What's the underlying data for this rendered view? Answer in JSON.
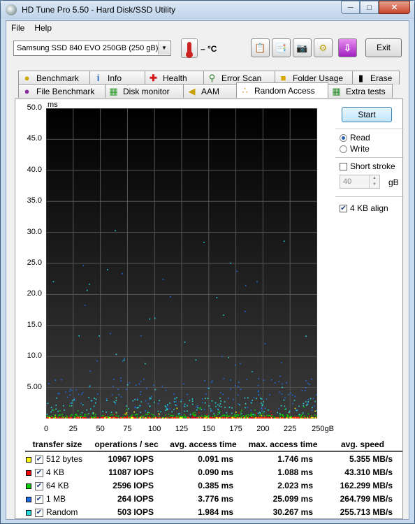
{
  "window": {
    "title": "HD Tune Pro 5.50 - Hard Disk/SSD Utility"
  },
  "menu": {
    "file": "File",
    "help": "Help"
  },
  "toolbar": {
    "drive": "Samsung SSD 840 EVO 250GB (250 gB)",
    "temperature": "– °C",
    "exit_label": "Exit",
    "buttons": [
      "copy-info-icon",
      "copy-screen-icon",
      "screenshot-icon",
      "options-icon",
      "save-icon"
    ]
  },
  "tabs_row1": [
    "Benchmark",
    "Info",
    "Health",
    "Error Scan",
    "Folder Usage",
    "Erase"
  ],
  "tabs_row2": [
    "File Benchmark",
    "Disk monitor",
    "AAM",
    "Random Access",
    "Extra tests"
  ],
  "active_tab": "Random Access",
  "side": {
    "start_label": "Start",
    "read_label": "Read",
    "write_label": "Write",
    "mode": "Read",
    "short_stroke_label": "Short stroke",
    "short_stroke_checked": false,
    "short_stroke_value": "40",
    "short_stroke_unit": "gB",
    "align_label": "4 KB align",
    "align_checked": true
  },
  "chart_data": {
    "type": "scatter",
    "ylabel": "ms",
    "xunit": "gB",
    "ylim": [
      0,
      50
    ],
    "xlim": [
      0,
      250
    ],
    "yticks": [
      "50.0",
      "45.0",
      "40.0",
      "35.0",
      "30.0",
      "25.0",
      "20.0",
      "15.0",
      "10.0",
      "5.00"
    ],
    "xticks": [
      "0",
      "25",
      "50",
      "75",
      "100",
      "125",
      "150",
      "175",
      "200",
      "225",
      "250gB"
    ],
    "grid": true,
    "background": "#000000",
    "series": [
      {
        "name": "512 bytes",
        "color": "#ffff00",
        "avg_ms": 0.091,
        "max_ms": 1.746
      },
      {
        "name": "4 KB",
        "color": "#ff0000",
        "avg_ms": 0.09,
        "max_ms": 1.088
      },
      {
        "name": "64 KB",
        "color": "#00cc00",
        "avg_ms": 0.385,
        "max_ms": 2.023
      },
      {
        "name": "1 MB",
        "color": "#1e6ee6",
        "avg_ms": 3.776,
        "max_ms": 25.099
      },
      {
        "name": "Random",
        "color": "#22dddd",
        "avg_ms": 1.984,
        "max_ms": 30.267
      }
    ]
  },
  "results": {
    "headers": [
      "transfer size",
      "operations / sec",
      "avg. access time",
      "max. access time",
      "avg. speed"
    ],
    "rows": [
      {
        "label": "512 bytes",
        "color": "#ffff00",
        "ops": "10967 IOPS",
        "avg": "0.091 ms",
        "max": "1.746 ms",
        "speed": "5.355 MB/s"
      },
      {
        "label": "4 KB",
        "color": "#ff0000",
        "ops": "11087 IOPS",
        "avg": "0.090 ms",
        "max": "1.088 ms",
        "speed": "43.310 MB/s"
      },
      {
        "label": "64 KB",
        "color": "#00cc00",
        "ops": "2596 IOPS",
        "avg": "0.385 ms",
        "max": "2.023 ms",
        "speed": "162.299 MB/s"
      },
      {
        "label": "1 MB",
        "color": "#1e6ee6",
        "ops": "264 IOPS",
        "avg": "3.776 ms",
        "max": "25.099 ms",
        "speed": "264.799 MB/s"
      },
      {
        "label": "Random",
        "color": "#22dddd",
        "ops": "503 IOPS",
        "avg": "1.984 ms",
        "max": "30.267 ms",
        "speed": "255.713 MB/s"
      }
    ]
  }
}
